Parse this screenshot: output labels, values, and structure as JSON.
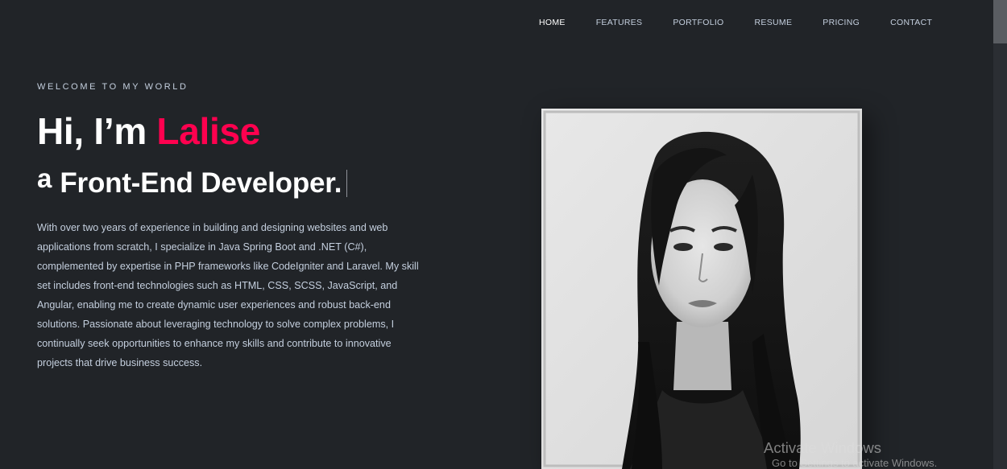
{
  "nav": {
    "items": [
      "HOME",
      "FEATURES",
      "PORTFOLIO",
      "RESUME",
      "PRICING",
      "CONTACT"
    ],
    "active": "HOME"
  },
  "hero": {
    "eyebrow": "WELCOME TO MY WORLD",
    "greeting": "Hi, I’m ",
    "name": "Lalise",
    "role_prefix": "a",
    "role": "Front-End Developer.",
    "bio": "With over two years of experience in building and designing websites and web applications from scratch, I specialize in Java Spring Boot and .NET (C#), complemented by expertise in PHP frameworks like CodeIgniter and Laravel. My skill set includes front-end technologies such as HTML, CSS, SCSS, JavaScript, and Angular, enabling me to create dynamic user experiences and robust back-end solutions. Passionate about leveraging technology to solve complex problems, I continually seek opportunities to enhance my skills and contribute to innovative projects that drive business success."
  },
  "watermark": {
    "title": "Activate Windows",
    "subtitle": "Go to Settings to activate Windows."
  },
  "colors": {
    "background": "#212428",
    "accent": "#ff014f",
    "text": "#c4cfde"
  }
}
